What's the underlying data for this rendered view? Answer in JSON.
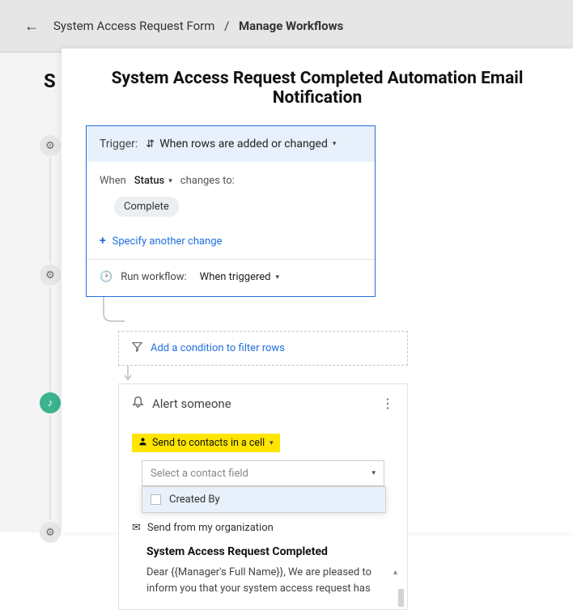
{
  "breadcrumb": {
    "parent": "System Access Request Form",
    "current": "Manage Workflows"
  },
  "panel": {
    "title": "System Access Request Completed Automation Email Notification"
  },
  "trigger": {
    "label": "Trigger:",
    "value": "When rows are added or changed",
    "when_label": "When",
    "field": "Status",
    "changes_to": "changes to:",
    "chip": "Complete",
    "add_change": "Specify another change",
    "run_label": "Run workflow:",
    "run_value": "When triggered"
  },
  "condition": {
    "link": "Add a condition to filter rows"
  },
  "alert": {
    "title": "Alert someone",
    "send_to_label": "Send to contacts in a cell",
    "contact_placeholder": "Select a contact field",
    "dropdown_option": "Created By",
    "send_from": "Send from my organization",
    "subject": "System Access Request Completed",
    "body": "Dear {{Manager's Full Name}}, We are pleased to inform you that your system access request has"
  }
}
